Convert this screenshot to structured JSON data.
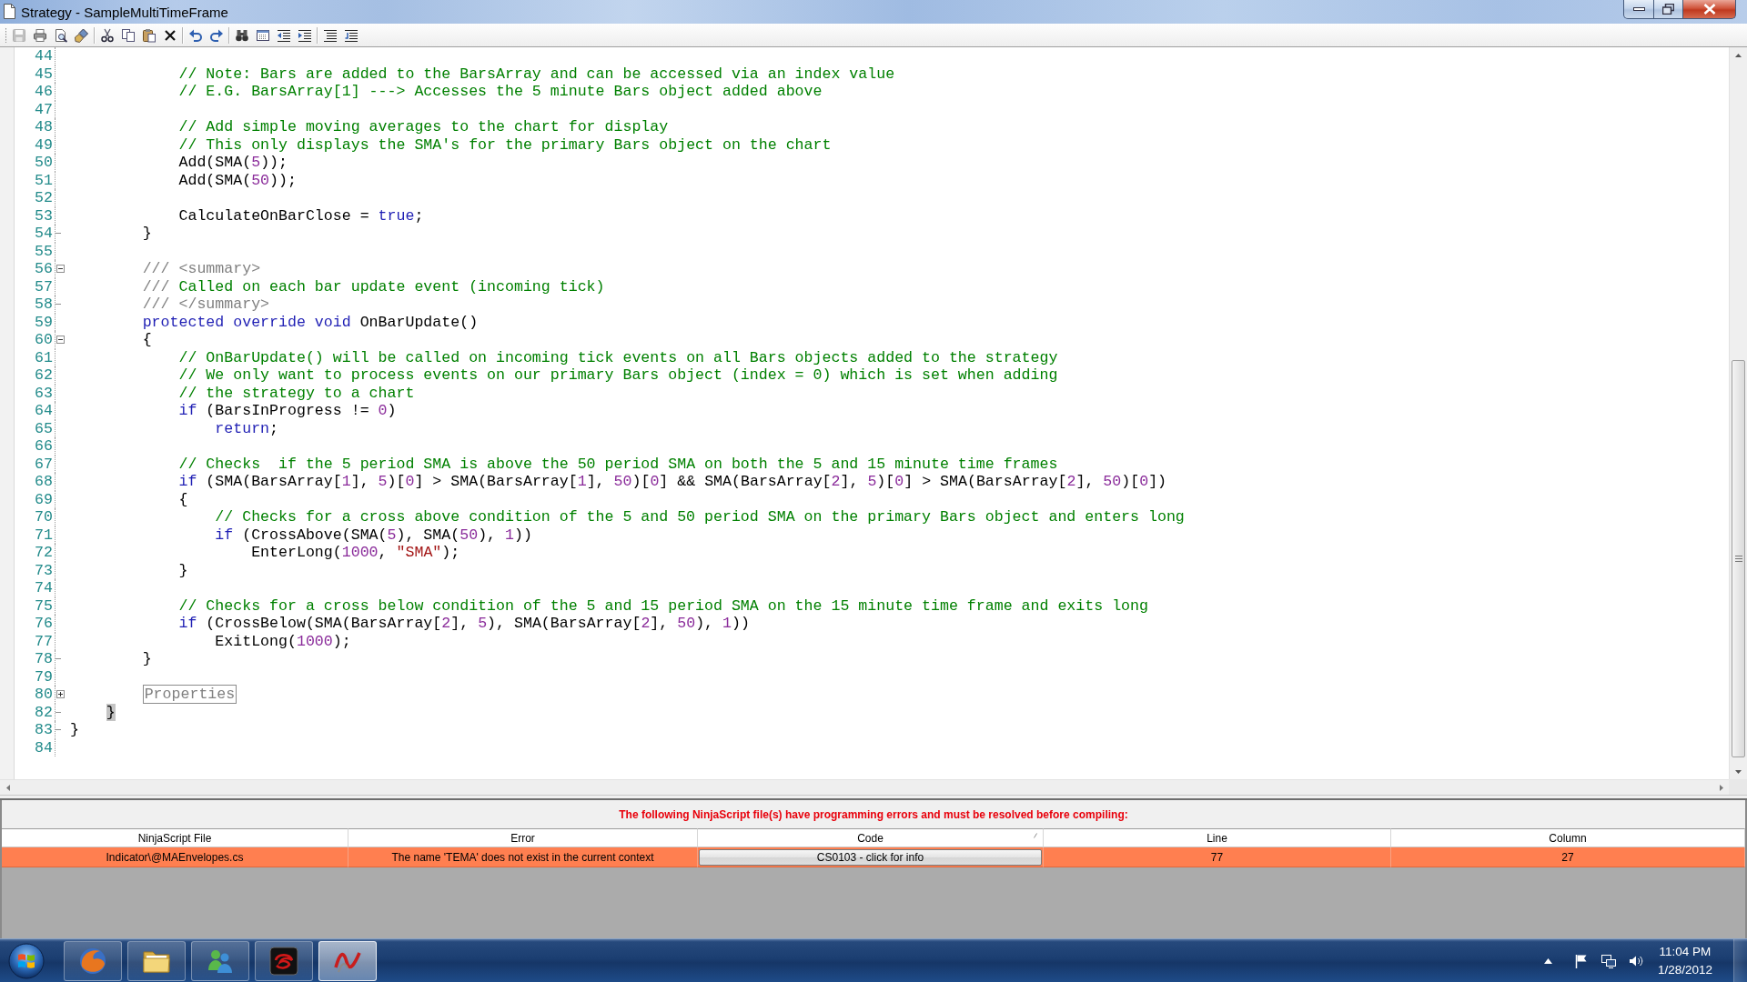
{
  "window": {
    "title": "Strategy - SampleMultiTimeFrame"
  },
  "toolbar": [
    {
      "kind": "save",
      "disabled": true
    },
    {
      "kind": "print",
      "disabled": false
    },
    {
      "kind": "preview",
      "disabled": false
    },
    {
      "kind": "format",
      "disabled": false
    },
    {
      "kind": "separator"
    },
    {
      "kind": "cut",
      "disabled": false
    },
    {
      "kind": "copy",
      "disabled": false
    },
    {
      "kind": "paste",
      "disabled": false
    },
    {
      "kind": "delete",
      "disabled": false
    },
    {
      "kind": "separator"
    },
    {
      "kind": "undo",
      "disabled": false
    },
    {
      "kind": "redo",
      "disabled": false
    },
    {
      "kind": "separator"
    },
    {
      "kind": "find",
      "disabled": false
    },
    {
      "kind": "grid",
      "disabled": false
    },
    {
      "kind": "outdent",
      "disabled": false
    },
    {
      "kind": "indent",
      "disabled": false
    },
    {
      "kind": "separator"
    },
    {
      "kind": "comment",
      "disabled": false
    },
    {
      "kind": "uncomment",
      "disabled": false
    }
  ],
  "editor": {
    "lines": [
      {
        "number": "44"
      },
      {
        "number": "45",
        "code": [
          {
            "kind": "comment",
            "text": "            // Note: Bars are added to the BarsArray and can be accessed via an index value"
          }
        ]
      },
      {
        "number": "46",
        "code": [
          {
            "kind": "comment",
            "text": "            // E.G. BarsArray[1] ---> Accesses the 5 minute Bars object added above"
          }
        ]
      },
      {
        "number": "47"
      },
      {
        "number": "48",
        "code": [
          {
            "kind": "comment",
            "text": "            // Add simple moving averages to the chart for display"
          }
        ]
      },
      {
        "number": "49",
        "code": [
          {
            "kind": "comment",
            "text": "            // This only displays the SMA's for the primary Bars object on the chart"
          }
        ]
      },
      {
        "number": "50",
        "code": [
          {
            "kind": "plain",
            "text": "            Add(SMA("
          },
          {
            "kind": "number",
            "text": "5"
          },
          {
            "kind": "plain",
            "text": "));"
          }
        ]
      },
      {
        "number": "51",
        "code": [
          {
            "kind": "plain",
            "text": "            Add(SMA("
          },
          {
            "kind": "number",
            "text": "50"
          },
          {
            "kind": "plain",
            "text": "));"
          }
        ]
      },
      {
        "number": "52"
      },
      {
        "number": "53",
        "code": [
          {
            "kind": "plain",
            "text": "            CalculateOnBarClose = "
          },
          {
            "kind": "keyword",
            "text": "true"
          },
          {
            "kind": "plain",
            "text": ";"
          }
        ]
      },
      {
        "number": "54",
        "marker": {
          "kind": "end"
        },
        "code": [
          {
            "kind": "plain",
            "text": "        }"
          }
        ]
      },
      {
        "number": "55"
      },
      {
        "number": "56",
        "marker": {
          "kind": "toggle",
          "expanded": true
        },
        "code": [
          {
            "kind": "doc",
            "text": "        /// <summary>"
          }
        ]
      },
      {
        "number": "57",
        "code": [
          {
            "kind": "doc",
            "text": "        /// "
          },
          {
            "kind": "comment",
            "text": "Called on each bar update event (incoming tick)"
          }
        ]
      },
      {
        "number": "58",
        "marker": {
          "kind": "end"
        },
        "code": [
          {
            "kind": "doc",
            "text": "        /// </summary>"
          }
        ]
      },
      {
        "number": "59",
        "code": [
          {
            "kind": "keyword",
            "text": "        protected override void"
          },
          {
            "kind": "plain",
            "text": " OnBarUpdate()"
          }
        ]
      },
      {
        "number": "60",
        "marker": {
          "kind": "toggle",
          "expanded": true
        },
        "code": [
          {
            "kind": "plain",
            "text": "        {"
          }
        ]
      },
      {
        "number": "61",
        "code": [
          {
            "kind": "comment",
            "text": "            // OnBarUpdate() will be called on incoming tick events on all Bars objects added to the strategy"
          }
        ]
      },
      {
        "number": "62",
        "code": [
          {
            "kind": "comment",
            "text": "            // We only want to process events on our primary Bars object (index = 0) which is set when adding"
          }
        ]
      },
      {
        "number": "63",
        "code": [
          {
            "kind": "comment",
            "text": "            // the strategy to a chart"
          }
        ]
      },
      {
        "number": "64",
        "code": [
          {
            "kind": "keyword",
            "text": "            if"
          },
          {
            "kind": "plain",
            "text": " (BarsInProgress != "
          },
          {
            "kind": "number",
            "text": "0"
          },
          {
            "kind": "plain",
            "text": ")"
          }
        ]
      },
      {
        "number": "65",
        "code": [
          {
            "kind": "keyword",
            "text": "                return"
          },
          {
            "kind": "plain",
            "text": ";"
          }
        ]
      },
      {
        "number": "66"
      },
      {
        "number": "67",
        "code": [
          {
            "kind": "comment",
            "text": "            // Checks  if the 5 period SMA is above the 50 period SMA on both the 5 and 15 minute time frames"
          }
        ]
      },
      {
        "number": "68",
        "code": [
          {
            "kind": "keyword",
            "text": "            if"
          },
          {
            "kind": "plain",
            "text": " (SMA(BarsArray["
          },
          {
            "kind": "number",
            "text": "1"
          },
          {
            "kind": "plain",
            "text": "], "
          },
          {
            "kind": "number",
            "text": "5"
          },
          {
            "kind": "plain",
            "text": ")["
          },
          {
            "kind": "number",
            "text": "0"
          },
          {
            "kind": "plain",
            "text": "] > SMA(BarsArray["
          },
          {
            "kind": "number",
            "text": "1"
          },
          {
            "kind": "plain",
            "text": "], "
          },
          {
            "kind": "number",
            "text": "50"
          },
          {
            "kind": "plain",
            "text": ")["
          },
          {
            "kind": "number",
            "text": "0"
          },
          {
            "kind": "plain",
            "text": "] && SMA(BarsArray["
          },
          {
            "kind": "number",
            "text": "2"
          },
          {
            "kind": "plain",
            "text": "], "
          },
          {
            "kind": "number",
            "text": "5"
          },
          {
            "kind": "plain",
            "text": ")["
          },
          {
            "kind": "number",
            "text": "0"
          },
          {
            "kind": "plain",
            "text": "] > SMA(BarsArray["
          },
          {
            "kind": "number",
            "text": "2"
          },
          {
            "kind": "plain",
            "text": "], "
          },
          {
            "kind": "number",
            "text": "50"
          },
          {
            "kind": "plain",
            "text": ")["
          },
          {
            "kind": "number",
            "text": "0"
          },
          {
            "kind": "plain",
            "text": "])"
          }
        ]
      },
      {
        "number": "69",
        "code": [
          {
            "kind": "plain",
            "text": "            {"
          }
        ]
      },
      {
        "number": "70",
        "code": [
          {
            "kind": "comment",
            "text": "                // Checks for a cross above condition of the 5 and 50 period SMA on the primary Bars object and enters long"
          }
        ]
      },
      {
        "number": "71",
        "code": [
          {
            "kind": "keyword",
            "text": "                if"
          },
          {
            "kind": "plain",
            "text": " (CrossAbove(SMA("
          },
          {
            "kind": "number",
            "text": "5"
          },
          {
            "kind": "plain",
            "text": "), SMA("
          },
          {
            "kind": "number",
            "text": "50"
          },
          {
            "kind": "plain",
            "text": "), "
          },
          {
            "kind": "number",
            "text": "1"
          },
          {
            "kind": "plain",
            "text": "))"
          }
        ]
      },
      {
        "number": "72",
        "code": [
          {
            "kind": "plain",
            "text": "                    EnterLong("
          },
          {
            "kind": "number",
            "text": "1000"
          },
          {
            "kind": "plain",
            "text": ", "
          },
          {
            "kind": "string",
            "text": "\"SMA\""
          },
          {
            "kind": "plain",
            "text": ");"
          }
        ]
      },
      {
        "number": "73",
        "code": [
          {
            "kind": "plain",
            "text": "            }"
          }
        ]
      },
      {
        "number": "74"
      },
      {
        "number": "75",
        "code": [
          {
            "kind": "comment",
            "text": "            // Checks for a cross below condition of the 5 and 15 period SMA on the 15 minute time frame and exits long"
          }
        ]
      },
      {
        "number": "76",
        "code": [
          {
            "kind": "keyword",
            "text": "            if"
          },
          {
            "kind": "plain",
            "text": " (CrossBelow(SMA(BarsArray["
          },
          {
            "kind": "number",
            "text": "2"
          },
          {
            "kind": "plain",
            "text": "], "
          },
          {
            "kind": "number",
            "text": "5"
          },
          {
            "kind": "plain",
            "text": "), SMA(BarsArray["
          },
          {
            "kind": "number",
            "text": "2"
          },
          {
            "kind": "plain",
            "text": "], "
          },
          {
            "kind": "number",
            "text": "50"
          },
          {
            "kind": "plain",
            "text": "), "
          },
          {
            "kind": "number",
            "text": "1"
          },
          {
            "kind": "plain",
            "text": "))"
          }
        ]
      },
      {
        "number": "77",
        "code": [
          {
            "kind": "plain",
            "text": "                ExitLong("
          },
          {
            "kind": "number",
            "text": "1000"
          },
          {
            "kind": "plain",
            "text": ");"
          }
        ]
      },
      {
        "number": "78",
        "marker": {
          "kind": "end"
        },
        "code": [
          {
            "kind": "plain",
            "text": "        }"
          }
        ]
      },
      {
        "number": "79"
      },
      {
        "number": "80",
        "marker": {
          "kind": "toggle",
          "expanded": false
        },
        "code": [
          {
            "kind": "region",
            "text": "        Properties"
          }
        ]
      },
      {
        "number": "82",
        "marker": {
          "kind": "end"
        },
        "code": [
          {
            "kind": "brace_match",
            "text": "    }"
          }
        ]
      },
      {
        "number": "83",
        "marker": {
          "kind": "end"
        },
        "code": [
          {
            "kind": "plain",
            "text": "}"
          }
        ]
      },
      {
        "number": "84"
      }
    ]
  },
  "errors": {
    "message": "The following NinjaScript file(s) have programming errors and must be resolved before compiling:",
    "columns": [
      {
        "label": "NinjaScript File",
        "sorted": false
      },
      {
        "label": "Error",
        "sorted": false
      },
      {
        "label": "Code",
        "sorted": true
      },
      {
        "label": "Line",
        "sorted": false
      },
      {
        "label": "Column",
        "sorted": false
      }
    ],
    "rows": [
      {
        "cells": [
          {
            "kind": "text",
            "text": "Indicator\\@MAEnvelopes.cs"
          },
          {
            "kind": "text",
            "text": "The name 'TEMA' does not exist in the current context"
          },
          {
            "kind": "button",
            "text": "CS0103 - click for info"
          },
          {
            "kind": "text",
            "text": "77"
          },
          {
            "kind": "text",
            "text": "27"
          }
        ]
      }
    ]
  },
  "taskbar": {
    "items": [
      {
        "kind": "browser",
        "selected": false
      },
      {
        "kind": "folder",
        "selected": false
      },
      {
        "kind": "people",
        "selected": false
      },
      {
        "kind": "swirl",
        "selected": false
      },
      {
        "kind": "wave",
        "selected": true
      }
    ],
    "clock": {
      "time": "11:04 PM",
      "date": "1/28/2012"
    }
  }
}
